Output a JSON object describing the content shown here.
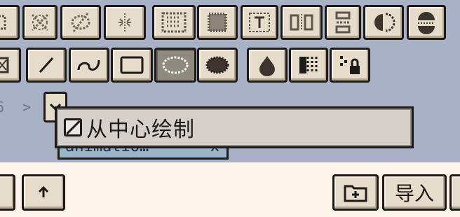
{
  "toolbar_row1": {
    "buttons": [
      {
        "icon": "fill-bucket-icon"
      },
      {
        "icon": "brush-shape-x-icon"
      },
      {
        "icon": "slash-circle-icon"
      },
      {
        "icon": "mirror-dots-icon"
      },
      {
        "icon": "sparse-dither-icon"
      },
      {
        "icon": "dense-dither-icon"
      },
      {
        "icon": "text-frame-icon"
      },
      {
        "icon": "column-split-icon"
      },
      {
        "icon": "stacked-rows-icon"
      },
      {
        "icon": "sphere-left-icon"
      },
      {
        "icon": "sphere-stripes-icon"
      }
    ]
  },
  "toolbar_row2": {
    "buttons": [
      {
        "icon": "rect-select-icon"
      },
      {
        "icon": "line-tool-icon"
      },
      {
        "icon": "curve-tool-icon"
      },
      {
        "icon": "rectangle-tool-icon"
      },
      {
        "icon": "ellipse-tool-icon",
        "active": true
      },
      {
        "icon": "filled-ellipse-icon"
      },
      {
        "icon": "drop-icon"
      },
      {
        "icon": "gradient-dither-icon"
      },
      {
        "icon": "dots-lock-icon"
      }
    ]
  },
  "breadcrumb": {
    "text": "6",
    "arrow": ">"
  },
  "tab": {
    "label": "animatio…",
    "close": "x"
  },
  "tooltip": {
    "label": "从中心绘制"
  },
  "bottom": {
    "up_icon": "up-arrow-icon",
    "new_folder_icon": "new-folder-icon",
    "import_label": "导入"
  }
}
